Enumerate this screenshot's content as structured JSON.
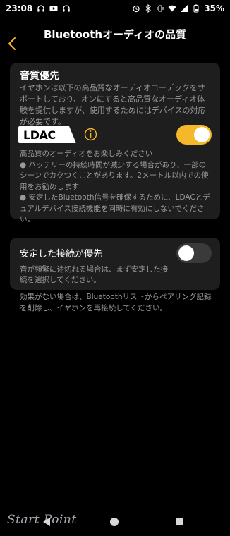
{
  "status_bar": {
    "time": "23:08",
    "battery": "35%"
  },
  "header": {
    "title": "Bluetoothオーディオの品質"
  },
  "audio_quality": {
    "title": "音質優先",
    "description": "イヤホンは以下の高品質なオーディオコーデックをサポートしており、オンにすると高品質なオーディオ体験を提供しますが、使用するためにはデバイスの対応が必要です。",
    "codec_label": "LDAC",
    "toggle_on": true,
    "line_1": "高品質のオーディオをお楽しみください",
    "line_2": "● バッテリーの持続時間が減少する場合があり、一部のシーンでカクつくことがあります。2メートル以内での使用をお勧めします",
    "line_3": "● 安定したBluetooth信号を確保するために、LDACとデュアルデバイス接続機能を同時に有効にしないでください。"
  },
  "stable_connection": {
    "title": "安定した接続が優先",
    "description": "音が頻繁に途切れる場合は、まず安定した接続を選択してください。",
    "toggle_on": false
  },
  "footer_note": "効果がない場合は、Bluetoothリストからペアリング記録を削除し、イヤホンを再接続してください。",
  "watermark": "Start Point",
  "colors": {
    "accent": "#f5b82a",
    "card_bg": "#1e1e1e",
    "secondary_text": "#9a9a9a"
  }
}
